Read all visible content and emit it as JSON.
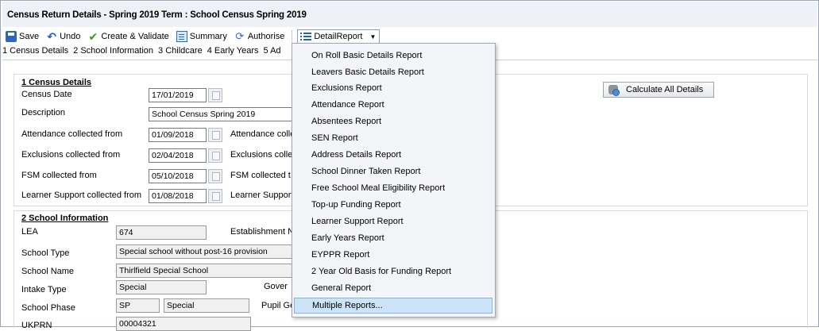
{
  "window": {
    "title": "Census Return Details - Spring 2019 Term : School Census Spring 2019"
  },
  "toolbar": {
    "save": "Save",
    "undo": "Undo",
    "create_validate": "Create & Validate",
    "summary": "Summary",
    "authorise": "Authorise",
    "detail_report": "DetailReport"
  },
  "tabs": [
    "1 Census Details",
    "2 School Information",
    "3 Childcare",
    "4 Early Years",
    "5 Ad"
  ],
  "census": {
    "heading": "1 Census Details",
    "census_date_label": "Census Date",
    "census_date": "17/01/2019",
    "description_label": "Description",
    "description": "School Census Spring 2019",
    "attendance_from_label": "Attendance collected from",
    "attendance_from": "01/09/2018",
    "attendance_to_label": "Attendance colle",
    "exclusions_from_label": "Exclusions collected from",
    "exclusions_from": "02/04/2018",
    "exclusions_to_label": "Exclusions colle",
    "fsm_from_label": "FSM collected from",
    "fsm_from": "05/10/2018",
    "fsm_to_label": "FSM collected t",
    "learner_support_from_label": "Learner Support collected from",
    "learner_support_from": "01/08/2018",
    "learner_support_to_label": "Learner Support",
    "calculate_button": "Calculate All Details"
  },
  "school": {
    "heading": "2 School Information",
    "lea_label": "LEA",
    "lea": "674",
    "establishment_label": "Establishment N",
    "school_type_label": "School Type",
    "school_type": "Special school without post-16 provision",
    "school_name_label": "School Name",
    "school_name": "Thirlfield Special School",
    "intake_type_label": "Intake Type",
    "intake_type": "Special",
    "governance_label": "Gover",
    "school_phase_label": "School Phase",
    "school_phase_code": "SP",
    "school_phase": "Special",
    "pupil_label": "Pupil Ge",
    "ukprn_label": "UKPRN",
    "ukprn": "00004321"
  },
  "menu": {
    "items": [
      "On Roll Basic Details Report",
      "Leavers Basic Details Report",
      "Exclusions Report",
      "Attendance Report",
      "Absentees Report",
      "SEN Report",
      "Address Details Report",
      "School Dinner Taken Report",
      "Free School Meal Eligibility Report",
      "Top-up Funding Report",
      "Learner Support Report",
      "Early Years Report",
      "EYPPR Report",
      "2 Year Old Basis for Funding Report",
      "General Report",
      "Multiple Reports..."
    ]
  }
}
